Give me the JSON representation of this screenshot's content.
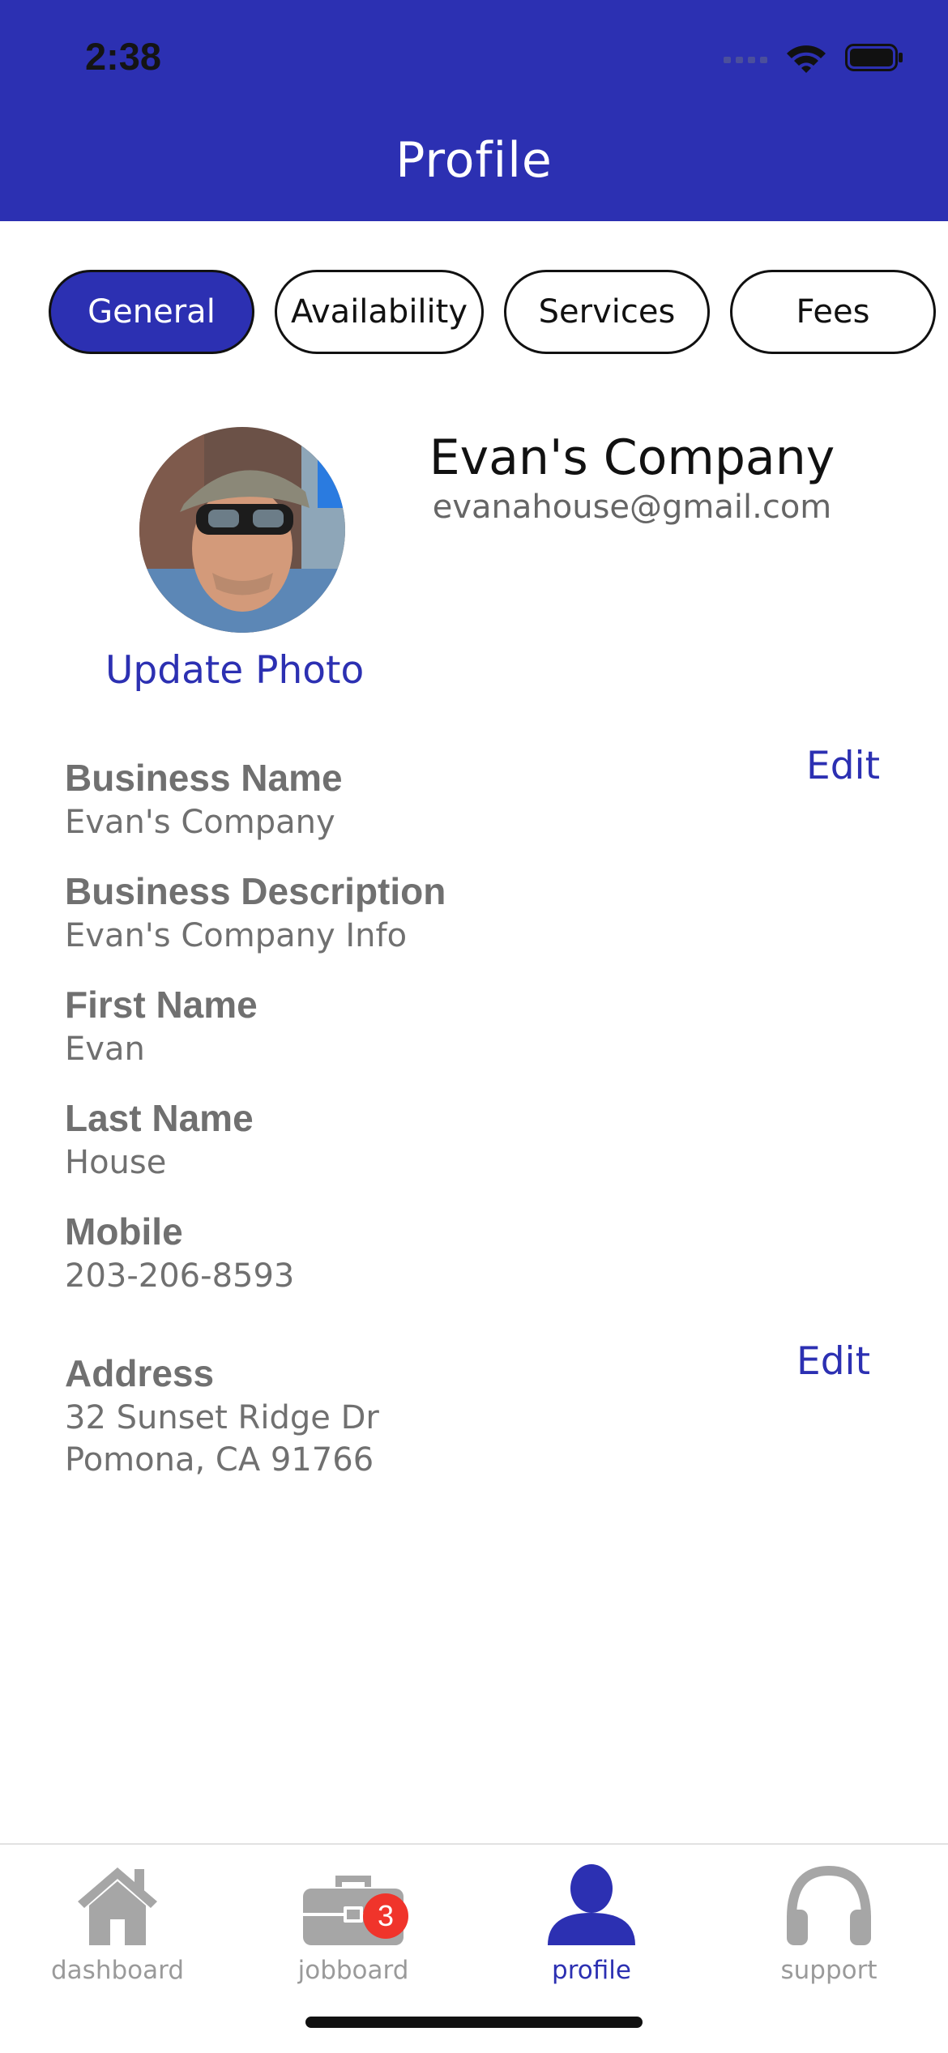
{
  "status_bar": {
    "time": "2:38"
  },
  "header": {
    "title": "Profile"
  },
  "tabs": [
    {
      "label": "General",
      "active": true
    },
    {
      "label": "Availability",
      "active": false
    },
    {
      "label": "Services",
      "active": false
    },
    {
      "label": "Fees",
      "active": false
    }
  ],
  "profile": {
    "company_name": "Evan's Company",
    "email": "evanahouse@gmail.com",
    "update_photo_label": "Update Photo"
  },
  "fields": {
    "business_name": {
      "label": "Business Name",
      "value": "Evan's Company"
    },
    "business_description": {
      "label": "Business Description",
      "value": "Evan's Company Info"
    },
    "first_name": {
      "label": "First Name",
      "value": "Evan"
    },
    "last_name": {
      "label": "Last Name",
      "value": "House"
    },
    "mobile": {
      "label": "Mobile",
      "value": "203-206-8593"
    },
    "address": {
      "label": "Address",
      "line1": "32 Sunset Ridge Dr",
      "line2": "Pomona, CA 91766"
    }
  },
  "edit_label": "Edit",
  "tabbar": {
    "items": [
      {
        "label": "dashboard",
        "icon": "house-icon",
        "active": false
      },
      {
        "label": "jobboard",
        "icon": "briefcase-icon",
        "active": false,
        "badge": "3"
      },
      {
        "label": "profile",
        "icon": "person-icon",
        "active": true
      },
      {
        "label": "support",
        "icon": "headphones-icon",
        "active": false
      }
    ]
  },
  "colors": {
    "accent": "#2c30b2",
    "badge": "#f0342b",
    "inactive": "#9a9a9a"
  }
}
